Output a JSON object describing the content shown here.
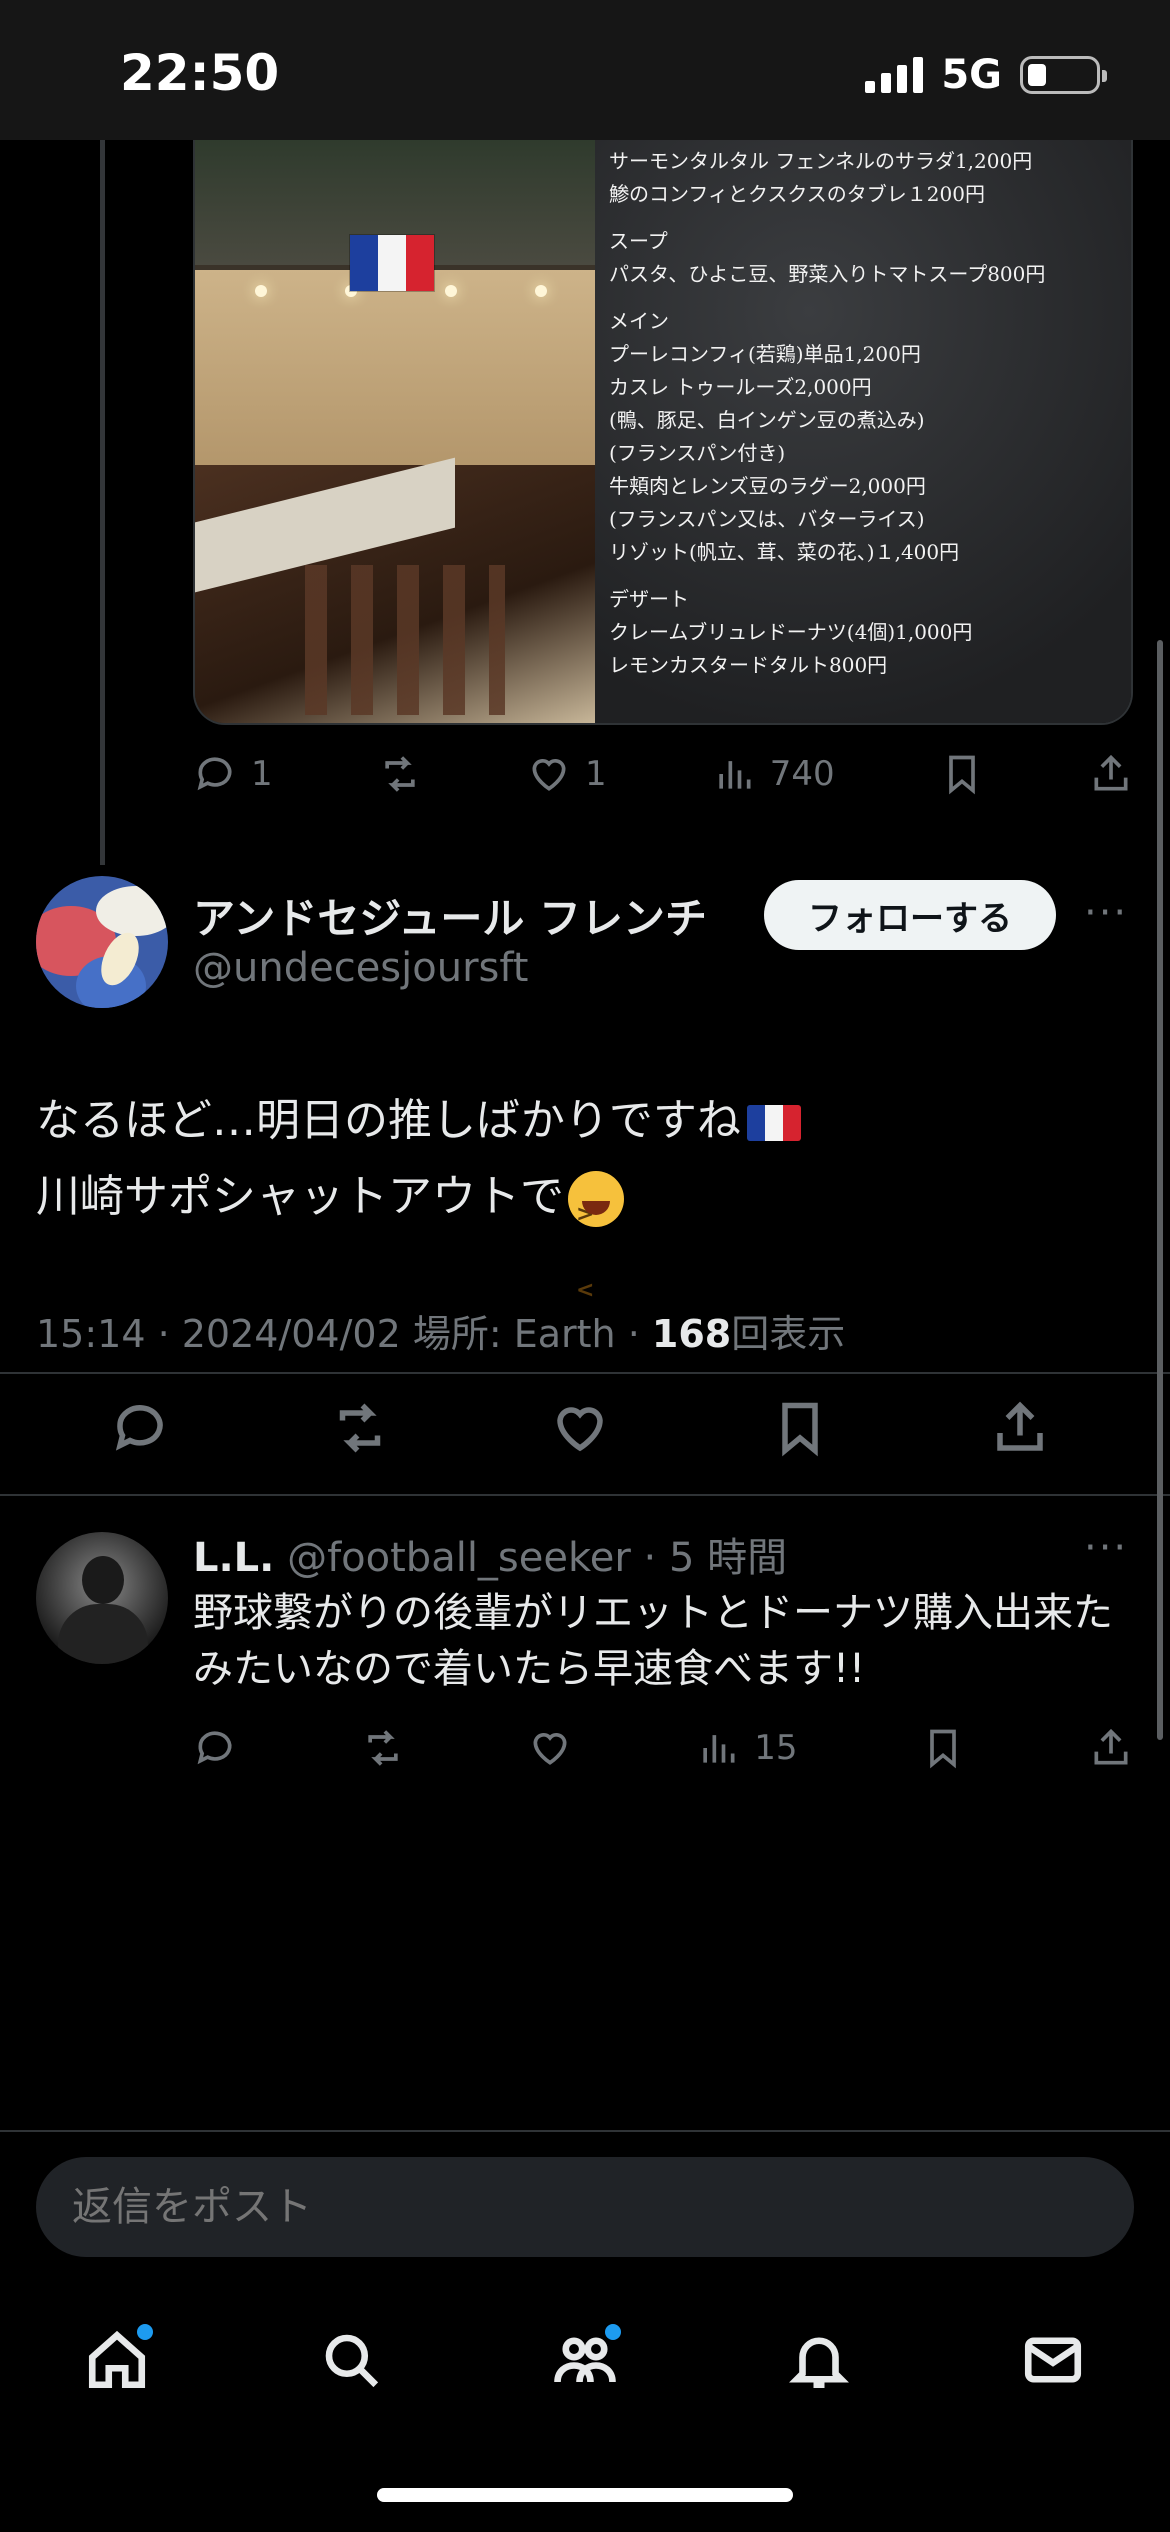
{
  "status_bar": {
    "time": "22:50",
    "network": "5G"
  },
  "menu_lines": [
    "サーモンタルタル フェンネルのサラダ1,200円",
    "鯵のコンフィとクスクスのタブレ１200円",
    "",
    "スープ",
    "パスタ、ひよこ豆、野菜入りトマトスープ800円",
    "",
    "メイン",
    "プーレコンフィ(若鶏)単品1,200円",
    "カスレ トゥールーズ2,000円",
    "(鴨、豚足、白インゲン豆の煮込み)",
    "(フランスパン付き)",
    "牛頬肉とレンズ豆のラグー2,000円",
    "(フランスパン又は、バターライス)",
    "リゾット(帆立、茸、菜の花、)１,400円",
    "",
    "デザート",
    "クレームブリュレドーナツ(4個)1,000円",
    "レモンカスタードタルト800円"
  ],
  "prev_tweet_actions": {
    "replies": "1",
    "likes": "1",
    "views": "740"
  },
  "focus_tweet": {
    "display_name": "アンドセジュール フレンチ",
    "handle": "@undecesjoursft",
    "follow_label": "フォローする",
    "more": "···",
    "line1": "なるほど…明日の推しばかりですね",
    "line2": "川崎サポシャットアウトで",
    "meta_prefix": "15:14 · 2024/04/02 場所: Earth · ",
    "views": "168",
    "views_suffix": "回表示"
  },
  "reply": {
    "name": "L.L.",
    "handle": "@football_seeker",
    "time": "· 5 時間",
    "more": "···",
    "text": "野球繋がりの後輩がリエットとドーナツ購入出来たみたいなので着いたら早速食べます!!",
    "views": "15"
  },
  "compose": {
    "placeholder": "返信をポスト"
  },
  "colors": {
    "accent": "#1d9bf0",
    "background": "#000000",
    "secondary_text": "#71767b",
    "france_blue": "#1d3f9e",
    "france_red": "#d6232f"
  },
  "icons": [
    "reply-icon",
    "repost-icon",
    "like-icon",
    "views-icon",
    "bookmark-icon",
    "share-icon",
    "home-icon",
    "search-icon",
    "communities-icon",
    "notifications-icon",
    "messages-icon"
  ]
}
